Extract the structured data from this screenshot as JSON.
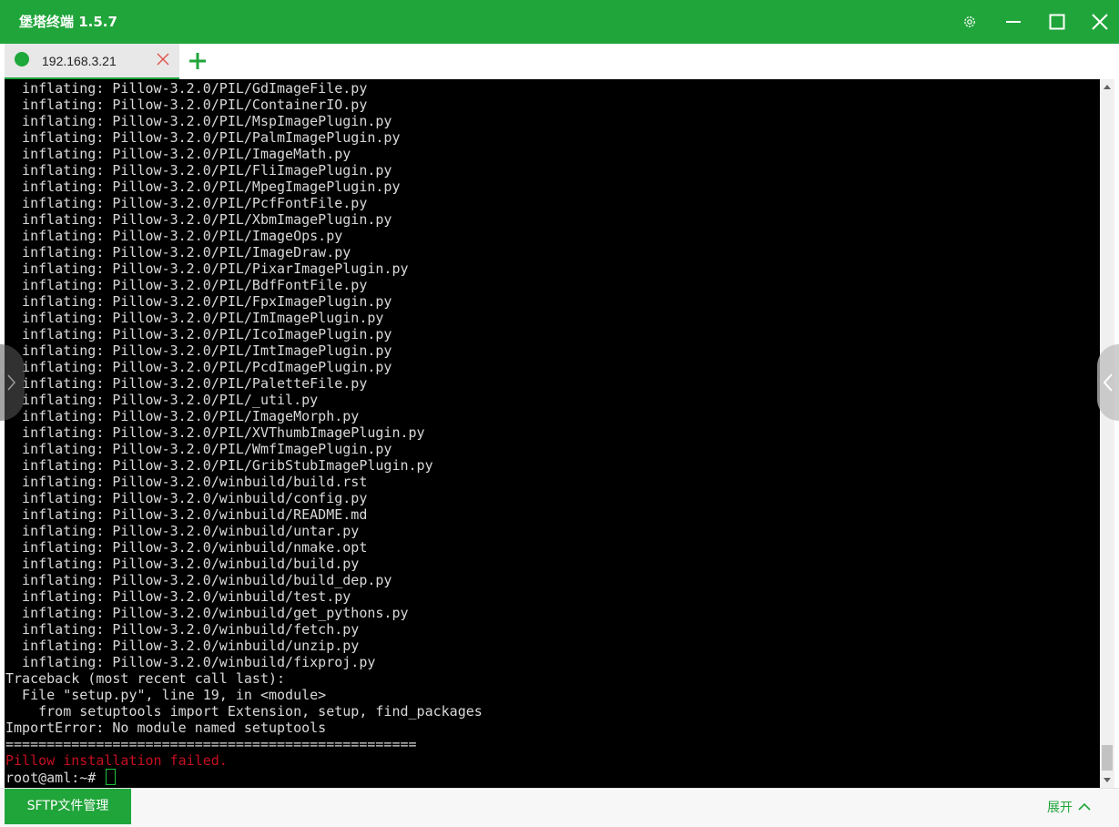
{
  "window": {
    "title": "堡塔终端 1.5.7"
  },
  "tabs": [
    {
      "label": "192.168.3.21",
      "status_color": "#1ea83c"
    }
  ],
  "terminal": {
    "lines": [
      "  inflating: Pillow-3.2.0/PIL/GdImageFile.py",
      "  inflating: Pillow-3.2.0/PIL/ContainerIO.py",
      "  inflating: Pillow-3.2.0/PIL/MspImagePlugin.py",
      "  inflating: Pillow-3.2.0/PIL/PalmImagePlugin.py",
      "  inflating: Pillow-3.2.0/PIL/ImageMath.py",
      "  inflating: Pillow-3.2.0/PIL/FliImagePlugin.py",
      "  inflating: Pillow-3.2.0/PIL/MpegImagePlugin.py",
      "  inflating: Pillow-3.2.0/PIL/PcfFontFile.py",
      "  inflating: Pillow-3.2.0/PIL/XbmImagePlugin.py",
      "  inflating: Pillow-3.2.0/PIL/ImageOps.py",
      "  inflating: Pillow-3.2.0/PIL/ImageDraw.py",
      "  inflating: Pillow-3.2.0/PIL/PixarImagePlugin.py",
      "  inflating: Pillow-3.2.0/PIL/BdfFontFile.py",
      "  inflating: Pillow-3.2.0/PIL/FpxImagePlugin.py",
      "  inflating: Pillow-3.2.0/PIL/ImImagePlugin.py",
      "  inflating: Pillow-3.2.0/PIL/IcoImagePlugin.py",
      "  inflating: Pillow-3.2.0/PIL/ImtImagePlugin.py",
      "  inflating: Pillow-3.2.0/PIL/PcdImagePlugin.py",
      "  inflating: Pillow-3.2.0/PIL/PaletteFile.py",
      "  inflating: Pillow-3.2.0/PIL/_util.py",
      "  inflating: Pillow-3.2.0/PIL/ImageMorph.py",
      "  inflating: Pillow-3.2.0/PIL/XVThumbImagePlugin.py",
      "  inflating: Pillow-3.2.0/PIL/WmfImagePlugin.py",
      "  inflating: Pillow-3.2.0/PIL/GribStubImagePlugin.py",
      "  inflating: Pillow-3.2.0/winbuild/build.rst",
      "  inflating: Pillow-3.2.0/winbuild/config.py",
      "  inflating: Pillow-3.2.0/winbuild/README.md",
      "  inflating: Pillow-3.2.0/winbuild/untar.py",
      "  inflating: Pillow-3.2.0/winbuild/nmake.opt",
      "  inflating: Pillow-3.2.0/winbuild/build.py",
      "  inflating: Pillow-3.2.0/winbuild/build_dep.py",
      "  inflating: Pillow-3.2.0/winbuild/test.py",
      "  inflating: Pillow-3.2.0/winbuild/get_pythons.py",
      "  inflating: Pillow-3.2.0/winbuild/fetch.py",
      "  inflating: Pillow-3.2.0/winbuild/unzip.py",
      "  inflating: Pillow-3.2.0/winbuild/fixproj.py",
      "Traceback (most recent call last):",
      "  File \"setup.py\", line 19, in <module>",
      "    from setuptools import Extension, setup, find_packages",
      "ImportError: No module named setuptools",
      "=================================================="
    ],
    "error_line": "Pillow installation failed.",
    "prompt": "root@aml:~#"
  },
  "bottom": {
    "sftp_label": "SFTP文件管理",
    "expand_label": "展开"
  },
  "colors": {
    "brand": "#20a53a",
    "terminal_bg": "#000000",
    "terminal_fg": "#d9d9d9",
    "error": "#c50f1f"
  },
  "icons": {
    "settings": "gear-icon",
    "minimize": "minimize-icon",
    "maximize": "maximize-icon",
    "close": "close-icon",
    "tab_close": "close-icon",
    "add_tab": "plus-icon",
    "expand": "chevron-up-icon"
  }
}
